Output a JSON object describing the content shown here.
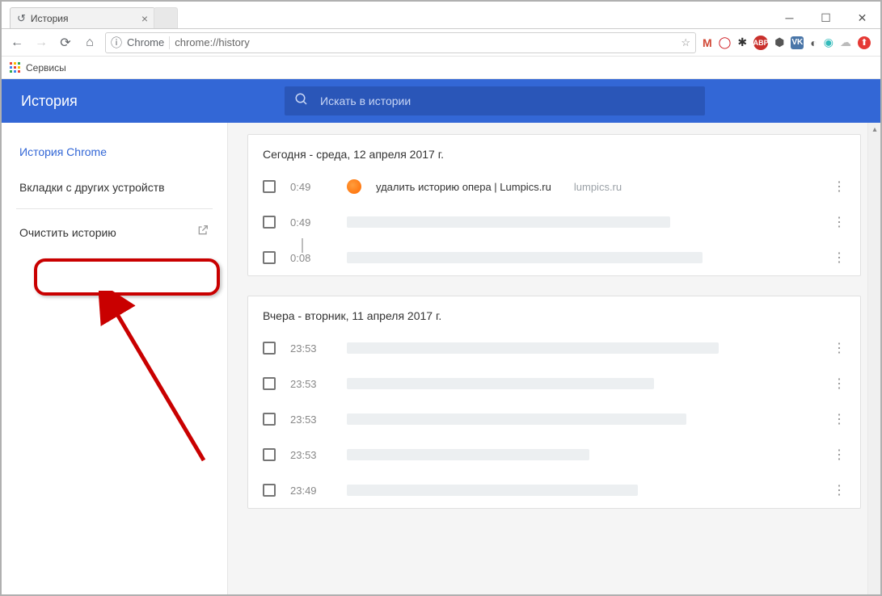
{
  "window": {
    "tab_title": "История"
  },
  "nav": {
    "chrome_label": "Chrome",
    "url": "chrome://history"
  },
  "bookmarks": {
    "services": "Сервисы"
  },
  "header": {
    "title": "История",
    "search_placeholder": "Искать в истории"
  },
  "sidebar": {
    "chrome_history": "История Chrome",
    "other_devices": "Вкладки с других устройств",
    "clear_history": "Очистить историю"
  },
  "history": {
    "sections": [
      {
        "heading": "Сегодня - среда, 12 апреля 2017 г.",
        "entries": [
          {
            "time": "0:49",
            "title": "удалить историю опера | Lumpics.ru",
            "domain": "lumpics.ru",
            "has_favicon": true,
            "placeholder": false
          },
          {
            "time": "0:49",
            "title": "",
            "domain": "",
            "has_favicon": false,
            "placeholder": true,
            "same_visit_indicator": true
          },
          {
            "time": "0:08",
            "title": "",
            "domain": "",
            "has_favicon": false,
            "placeholder": true
          }
        ]
      },
      {
        "heading": "Вчера - вторник, 11 апреля 2017 г.",
        "entries": [
          {
            "time": "23:53",
            "title": "",
            "domain": "",
            "has_favicon": false,
            "placeholder": true
          },
          {
            "time": "23:53",
            "title": "",
            "domain": "",
            "has_favicon": false,
            "placeholder": true
          },
          {
            "time": "23:53",
            "title": "",
            "domain": "",
            "has_favicon": false,
            "placeholder": true
          },
          {
            "time": "23:53",
            "title": "",
            "domain": "",
            "has_favicon": false,
            "placeholder": true
          },
          {
            "time": "23:49",
            "title": "",
            "domain": "",
            "has_favicon": false,
            "placeholder": true
          }
        ]
      }
    ]
  }
}
